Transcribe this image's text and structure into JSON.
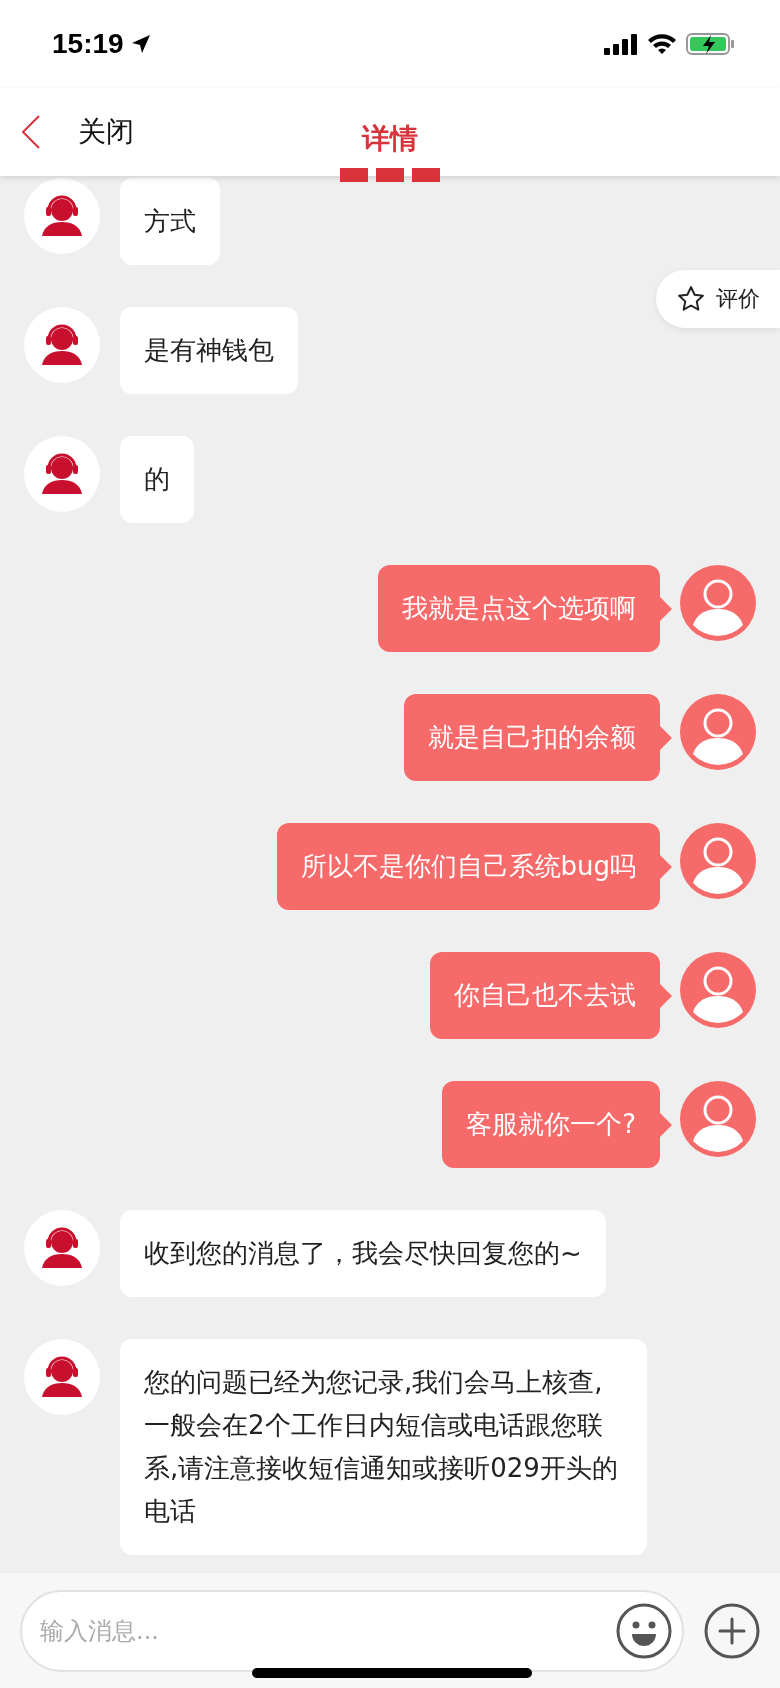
{
  "status_bar": {
    "time": "15:19"
  },
  "header": {
    "back_label": "关闭",
    "title": "详情"
  },
  "rate_button": {
    "label": "评价"
  },
  "messages": [
    {
      "kind": "incoming",
      "text": "方式"
    },
    {
      "kind": "incoming",
      "text": "是有神钱包"
    },
    {
      "kind": "incoming",
      "text": "的"
    },
    {
      "kind": "outgoing",
      "text": "我就是点这个选项啊"
    },
    {
      "kind": "outgoing",
      "text": "就是自己扣的余额"
    },
    {
      "kind": "outgoing",
      "text": "所以不是你们自己系统bug吗"
    },
    {
      "kind": "outgoing",
      "text": "你自己也不去试"
    },
    {
      "kind": "outgoing",
      "text": "客服就你一个?"
    },
    {
      "kind": "incoming",
      "text": "收到您的消息了，我会尽快回复您的~"
    },
    {
      "kind": "incoming",
      "text": "您的问题已经为您记录,我们会马上核查,一般会在2个工作日内短信或电话跟您联系,请注意接收短信通知或接听029开头的电话"
    }
  ],
  "input": {
    "placeholder": "输入消息..."
  }
}
